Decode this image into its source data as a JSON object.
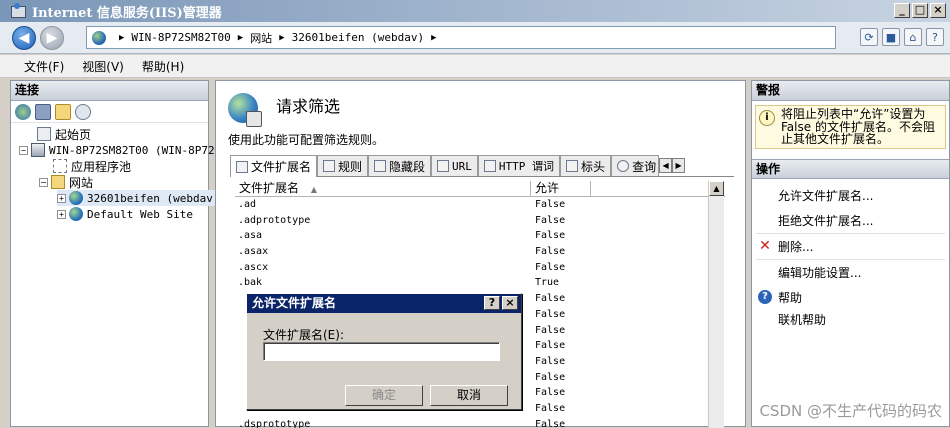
{
  "window": {
    "title": "Internet 信息服务(IIS)管理器",
    "buttons": [
      "_",
      "□",
      "×"
    ]
  },
  "address": {
    "crumbs": [
      "WIN-8P72SM82T00",
      "网站",
      "32601beifen (webdav)"
    ],
    "icons": [
      "refresh-icon",
      "stop-icon",
      "home-icon",
      "help-icon"
    ]
  },
  "menu": [
    "文件(F)",
    "视图(V)",
    "帮助(H)"
  ],
  "connections": {
    "header": "连接",
    "tree": [
      {
        "label": "起始页",
        "icon": "page"
      },
      {
        "label": "WIN-8P72SM82T00 (WIN-8P72S",
        "icon": "server",
        "toggle": "−"
      },
      {
        "label": "应用程序池",
        "icon": "pool"
      },
      {
        "label": "网站",
        "icon": "folder",
        "toggle": "−"
      },
      {
        "label": "32601beifen (webdav)",
        "icon": "globe",
        "toggle": "+"
      },
      {
        "label": "Default Web Site",
        "icon": "globe",
        "toggle": "+"
      }
    ]
  },
  "feature": {
    "title": "请求筛选",
    "description": "使用此功能可配置筛选规则。",
    "tabs": [
      "文件扩展名",
      "规则",
      "隐藏段",
      "URL",
      "HTTP 谓词",
      "标头",
      "查询"
    ],
    "columns": [
      "文件扩展名",
      "允许"
    ],
    "rows": [
      [
        ".ad",
        "False"
      ],
      [
        ".adprototype",
        "False"
      ],
      [
        ".asa",
        "False"
      ],
      [
        ".asax",
        "False"
      ],
      [
        ".ascx",
        "False"
      ],
      [
        ".bak",
        "True"
      ],
      [
        "",
        "False"
      ],
      [
        "",
        "False"
      ],
      [
        "",
        "False"
      ],
      [
        "",
        "False"
      ],
      [
        "",
        "False"
      ],
      [
        "",
        "False"
      ],
      [
        "",
        "False"
      ],
      [
        "",
        "False"
      ],
      [
        ".dsprototype",
        "False"
      ]
    ]
  },
  "alerts": {
    "header": "警报",
    "message": "将阻止列表中“允许”设置为 False 的文件扩展名。不会阻止其他文件扩展名。"
  },
  "actions": {
    "header": "操作",
    "items": [
      {
        "label": "允许文件扩展名...",
        "icon": ""
      },
      {
        "label": "拒绝文件扩展名...",
        "icon": ""
      },
      {
        "label": "删除...",
        "icon": "delete-icon"
      },
      {
        "label": "编辑功能设置...",
        "icon": ""
      },
      {
        "label": "帮助",
        "icon": "help-icon"
      },
      {
        "label": "联机帮助",
        "icon": ""
      }
    ]
  },
  "dialog": {
    "title": "允许文件扩展名",
    "field_label": "文件扩展名(E):",
    "field_value": "",
    "ok_label": "确定",
    "cancel_label": "取消",
    "title_buttons": [
      "?",
      "×"
    ]
  },
  "watermark": "CSDN @不生产代码的码农"
}
